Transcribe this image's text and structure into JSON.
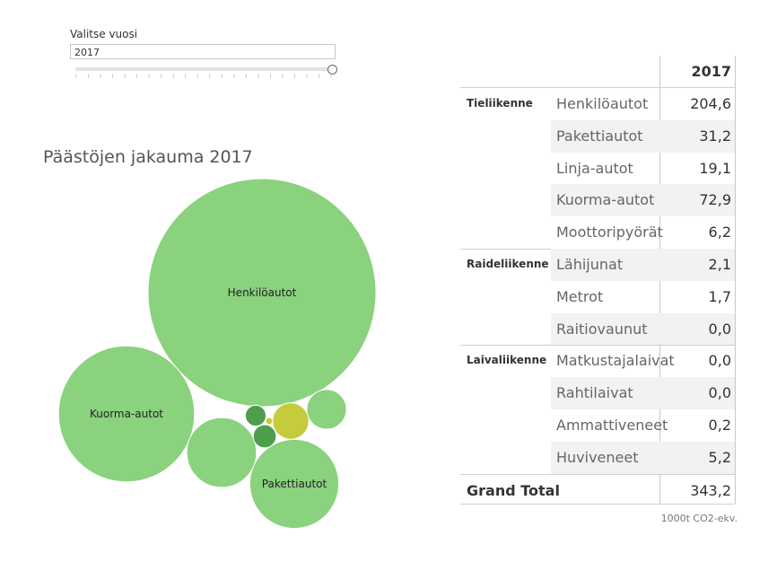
{
  "filter": {
    "label": "Valitse vuosi",
    "value": "2017",
    "slider_position": 1.0
  },
  "chart_data": {
    "type": "bubble",
    "title": "Päästöjen jakauma 2017",
    "units": "1000t CO2-ekv.",
    "items": [
      {
        "name": "Henkilöautot",
        "category": "Tieliikenne",
        "value": 204.6,
        "color": "#8ad27e",
        "label": true
      },
      {
        "name": "Kuorma-autot",
        "category": "Tieliikenne",
        "value": 72.9,
        "color": "#8ad27e",
        "label": true
      },
      {
        "name": "Pakettiautot",
        "category": "Tieliikenne",
        "value": 31.2,
        "color": "#8ad27e",
        "label": true
      },
      {
        "name": "Linja-autot",
        "category": "Tieliikenne",
        "value": 19.1,
        "color": "#8ad27e",
        "label": false
      },
      {
        "name": "Moottoripyörät",
        "category": "Tieliikenne",
        "value": 6.2,
        "color": "#8ad27e",
        "label": false
      },
      {
        "name": "Huviveneet",
        "category": "Laivaliikenne",
        "value": 5.2,
        "color": "#c5cc3b",
        "label": false
      },
      {
        "name": "Lähijunat",
        "category": "Raideliikenne",
        "value": 2.1,
        "color": "#4e9e4d",
        "label": false
      },
      {
        "name": "Metrot",
        "category": "Raideliikenne",
        "value": 1.7,
        "color": "#4e9e4d",
        "label": false
      },
      {
        "name": "Ammattiveneet",
        "category": "Laivaliikenne",
        "value": 0.2,
        "color": "#c5cc3b",
        "label": false
      }
    ]
  },
  "table": {
    "column_header": "2017",
    "groups": [
      {
        "name": "Tieliikenne",
        "rows": [
          {
            "label": "Henkilöautot",
            "value": "204,6"
          },
          {
            "label": "Pakettiautot",
            "value": "31,2"
          },
          {
            "label": "Linja-autot",
            "value": "19,1"
          },
          {
            "label": "Kuorma-autot",
            "value": "72,9"
          },
          {
            "label": "Moottoripyörät",
            "value": "6,2"
          }
        ]
      },
      {
        "name": "Raideliikenne",
        "rows": [
          {
            "label": "Lähijunat",
            "value": "2,1"
          },
          {
            "label": "Metrot",
            "value": "1,7"
          },
          {
            "label": "Raitiovaunut",
            "value": "0,0"
          }
        ]
      },
      {
        "name": "Laivaliikenne",
        "rows": [
          {
            "label": "Matkustajalaivat",
            "value": "0,0"
          },
          {
            "label": "Rahtilaivat",
            "value": "0,0"
          },
          {
            "label": "Ammattiveneet",
            "value": "0,2"
          },
          {
            "label": "Huviveneet",
            "value": "5,2"
          }
        ]
      }
    ],
    "grand_total_label": "Grand Total",
    "grand_total_value": "343,2"
  }
}
